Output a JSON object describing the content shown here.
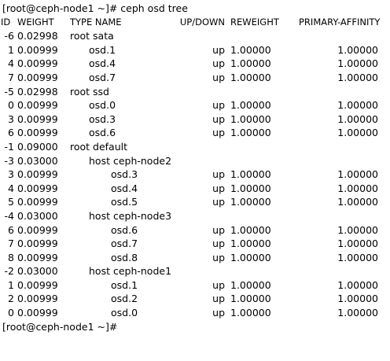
{
  "prompt_lines": {
    "first": "[root@ceph-node1 ~]# ceph osd tree",
    "last": "[root@ceph-node1 ~]#"
  },
  "header": {
    "id": "ID",
    "weight": "WEIGHT",
    "type_name": "TYPE NAME",
    "updown": "UP/DOWN",
    "reweight": "REWEIGHT",
    "affinity": "PRIMARY-AFFINITY"
  },
  "rows": [
    {
      "id": "-6",
      "weight": "0.02998",
      "name": "root sata",
      "level": 0,
      "status": "",
      "reweight": "",
      "affinity": ""
    },
    {
      "id": "1",
      "weight": "0.00999",
      "name": "osd.1",
      "level": 1,
      "status": "up",
      "reweight": "1.00000",
      "affinity": "1.00000"
    },
    {
      "id": "4",
      "weight": "0.00999",
      "name": "osd.4",
      "level": 1,
      "status": "up",
      "reweight": "1.00000",
      "affinity": "1.00000"
    },
    {
      "id": "7",
      "weight": "0.00999",
      "name": "osd.7",
      "level": 1,
      "status": "up",
      "reweight": "1.00000",
      "affinity": "1.00000"
    },
    {
      "id": "-5",
      "weight": "0.02998",
      "name": "root ssd",
      "level": 0,
      "status": "",
      "reweight": "",
      "affinity": ""
    },
    {
      "id": "0",
      "weight": "0.00999",
      "name": "osd.0",
      "level": 1,
      "status": "up",
      "reweight": "1.00000",
      "affinity": "1.00000"
    },
    {
      "id": "3",
      "weight": "0.00999",
      "name": "osd.3",
      "level": 1,
      "status": "up",
      "reweight": "1.00000",
      "affinity": "1.00000"
    },
    {
      "id": "6",
      "weight": "0.00999",
      "name": "osd.6",
      "level": 1,
      "status": "up",
      "reweight": "1.00000",
      "affinity": "1.00000"
    },
    {
      "id": "-1",
      "weight": "0.09000",
      "name": "root default",
      "level": 0,
      "status": "",
      "reweight": "",
      "affinity": ""
    },
    {
      "id": "-3",
      "weight": "0.03000",
      "name": "host ceph-node2",
      "level": 1,
      "status": "",
      "reweight": "",
      "affinity": ""
    },
    {
      "id": "3",
      "weight": "0.00999",
      "name": "osd.3",
      "level": 2,
      "status": "up",
      "reweight": "1.00000",
      "affinity": "1.00000"
    },
    {
      "id": "4",
      "weight": "0.00999",
      "name": "osd.4",
      "level": 2,
      "status": "up",
      "reweight": "1.00000",
      "affinity": "1.00000"
    },
    {
      "id": "5",
      "weight": "0.00999",
      "name": "osd.5",
      "level": 2,
      "status": "up",
      "reweight": "1.00000",
      "affinity": "1.00000"
    },
    {
      "id": "-4",
      "weight": "0.03000",
      "name": "host ceph-node3",
      "level": 1,
      "status": "",
      "reweight": "",
      "affinity": ""
    },
    {
      "id": "6",
      "weight": "0.00999",
      "name": "osd.6",
      "level": 2,
      "status": "up",
      "reweight": "1.00000",
      "affinity": "1.00000"
    },
    {
      "id": "7",
      "weight": "0.00999",
      "name": "osd.7",
      "level": 2,
      "status": "up",
      "reweight": "1.00000",
      "affinity": "1.00000"
    },
    {
      "id": "8",
      "weight": "0.00999",
      "name": "osd.8",
      "level": 2,
      "status": "up",
      "reweight": "1.00000",
      "affinity": "1.00000"
    },
    {
      "id": "-2",
      "weight": "0.03000",
      "name": "host ceph-node1",
      "level": 1,
      "status": "",
      "reweight": "",
      "affinity": ""
    },
    {
      "id": "1",
      "weight": "0.00999",
      "name": "osd.1",
      "level": 2,
      "status": "up",
      "reweight": "1.00000",
      "affinity": "1.00000"
    },
    {
      "id": "2",
      "weight": "0.00999",
      "name": "osd.2",
      "level": 2,
      "status": "up",
      "reweight": "1.00000",
      "affinity": "1.00000"
    },
    {
      "id": "0",
      "weight": "0.00999",
      "name": "osd.0",
      "level": 2,
      "status": "up",
      "reweight": "1.00000",
      "affinity": "1.00000"
    }
  ]
}
